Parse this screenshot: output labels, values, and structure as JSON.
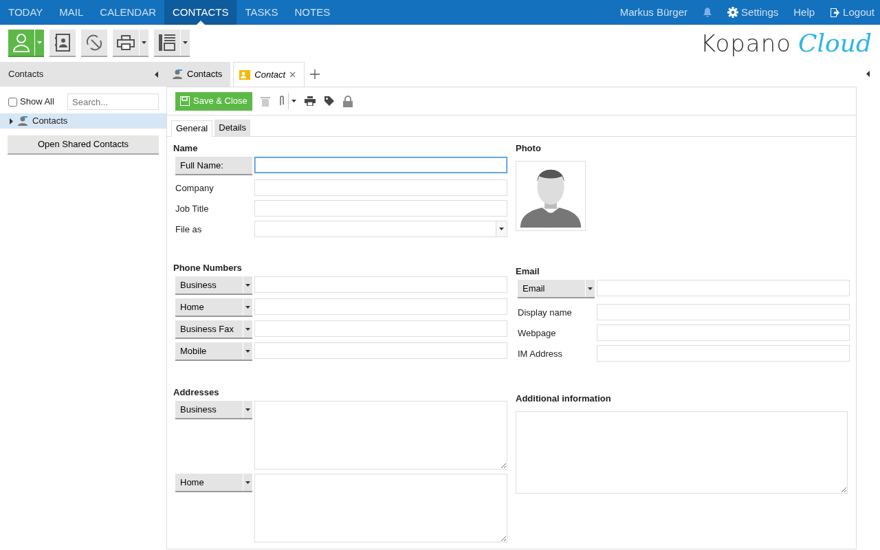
{
  "nav": {
    "items": [
      {
        "label": "TODAY",
        "selected": false
      },
      {
        "label": "MAIL",
        "selected": false
      },
      {
        "label": "CALENDAR",
        "selected": false
      },
      {
        "label": "CONTACTS",
        "selected": true
      },
      {
        "label": "TASKS",
        "selected": false
      },
      {
        "label": "NOTES",
        "selected": false
      }
    ],
    "user": "Markus Bürger",
    "settings": "Settings",
    "help": "Help",
    "logout": "Logout"
  },
  "logo": {
    "word": "Kopano",
    "script": "Cloud"
  },
  "sidebar": {
    "title": "Contacts",
    "show_all": {
      "label": "Show All",
      "checked": false
    },
    "search": {
      "placeholder": "Search..."
    },
    "tree": [
      {
        "label": "Contacts",
        "selected": true,
        "expanded": false
      }
    ],
    "button": "Open Shared Contacts"
  },
  "tabs": [
    {
      "label": "Contacts",
      "selected": false,
      "kind": "folder"
    },
    {
      "label": "Contact",
      "selected": true,
      "kind": "item"
    }
  ],
  "form_toolbar": {
    "save": "Save & Close"
  },
  "subtabs": [
    {
      "label": "General",
      "selected": true
    },
    {
      "label": "Details",
      "selected": false
    }
  ],
  "name": {
    "title": "Name",
    "rows": [
      {
        "label": "Full Name:",
        "kind": "button",
        "focused": true
      },
      {
        "label": "Company",
        "kind": "text",
        "focused": false
      },
      {
        "label": "Job Title",
        "kind": "text",
        "focused": false
      },
      {
        "label": "File as",
        "kind": "select",
        "focused": false
      }
    ]
  },
  "photo": {
    "title": "Photo"
  },
  "phone": {
    "title": "Phone Numbers",
    "rows": [
      {
        "label": "Business"
      },
      {
        "label": "Home"
      },
      {
        "label": "Business Fax"
      },
      {
        "label": "Mobile"
      }
    ]
  },
  "email": {
    "title": "Email",
    "rows": [
      {
        "label": "Email",
        "kind": "dropdown"
      },
      {
        "label": "Display name",
        "kind": "text"
      },
      {
        "label": "Webpage",
        "kind": "text"
      },
      {
        "label": "IM Address",
        "kind": "text"
      }
    ]
  },
  "addresses": {
    "title": "Addresses",
    "rows": [
      {
        "label": "Business"
      },
      {
        "label": "Home"
      }
    ]
  },
  "additional": {
    "title": "Additional information"
  }
}
